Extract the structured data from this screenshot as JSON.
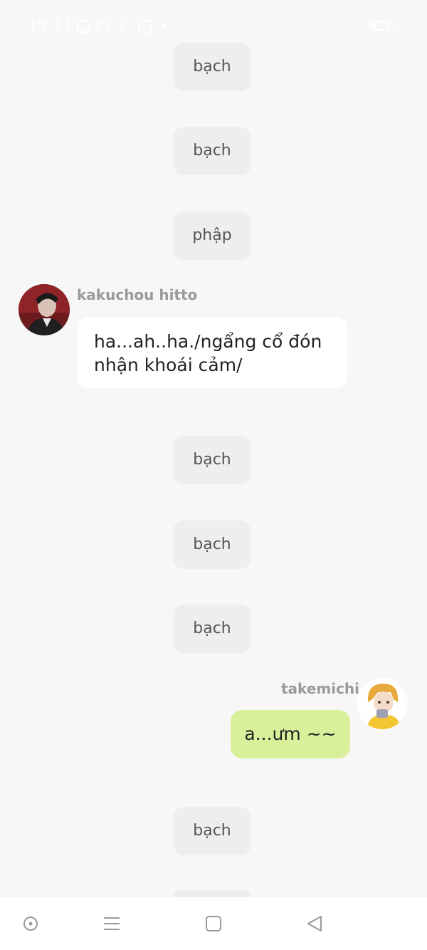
{
  "status_bar": {
    "time": "19:11",
    "signal_text": ". . .",
    "notification_icons": [
      "facebook-icon",
      "messenger-icon",
      "tiktok-icon",
      "youtube-icon"
    ]
  },
  "chat": {
    "narrations": [
      "bạch",
      "bạch",
      "phập",
      "bạch",
      "bạch",
      "bạch",
      "bạch"
    ],
    "message_kakuchou": {
      "username": "kakuchou hitto",
      "lines": [
        "ha...ah..ha./ngẩng cổ đón",
        "nhận khoái cảm/"
      ]
    },
    "message_takemichi": {
      "username": "takemichi",
      "text": "a...ưm ~~"
    }
  },
  "colors": {
    "background": "#f7f7f7",
    "narration_bubble": "#eeeeee",
    "incoming_bubble": "#ffffff",
    "outgoing_bubble": "#d8f09a",
    "username": "#9a9a9a"
  },
  "nav_bar": {
    "icons": [
      "assistant-icon",
      "menu-icon",
      "home-square-icon",
      "back-triangle-icon"
    ]
  }
}
